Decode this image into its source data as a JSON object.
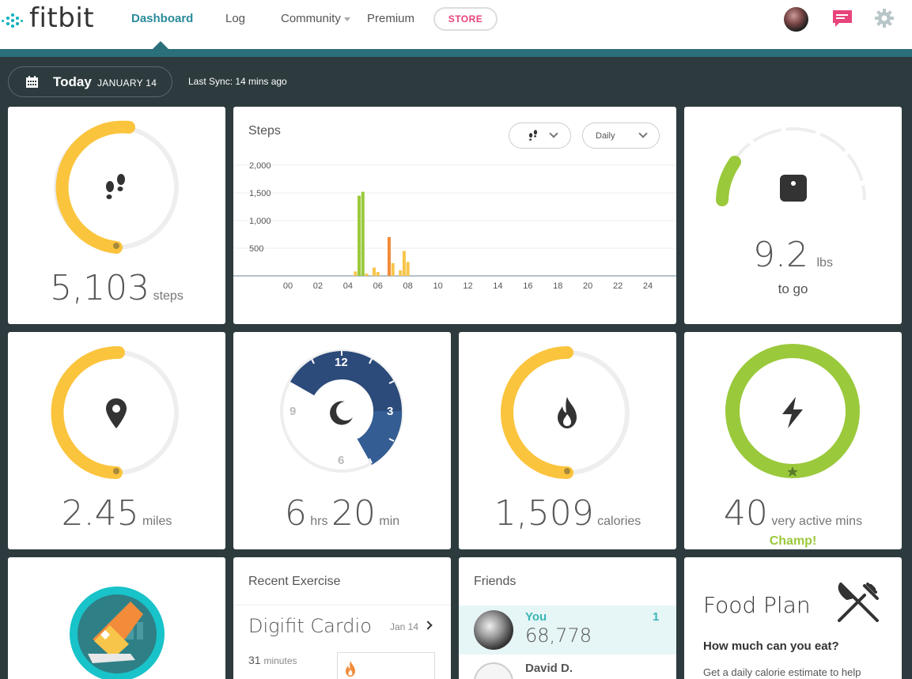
{
  "nav": {
    "logo_text": "fitbit",
    "items": [
      {
        "label": "Dashboard",
        "active": true
      },
      {
        "label": "Log",
        "active": false
      },
      {
        "label": "Community",
        "active": false
      },
      {
        "label": "Premium",
        "active": false
      }
    ],
    "store_label": "STORE",
    "icons": [
      "avatar",
      "message-icon",
      "gear-icon"
    ]
  },
  "datebar": {
    "today_label": "Today",
    "date_label": "JANUARY 14",
    "last_sync": "Last Sync: 14 mins ago"
  },
  "steps_tile": {
    "value": "5,103",
    "unit": "steps",
    "progress": 0.51,
    "icon": "footsteps-icon"
  },
  "steps_chart_card": {
    "title": "Steps",
    "type_dropdown_icon": "footsteps-icon",
    "period_dropdown": "Daily",
    "chart_data": {
      "type": "bar",
      "x_tick_labels": [
        "00",
        "02",
        "04",
        "06",
        "08",
        "10",
        "12",
        "14",
        "16",
        "18",
        "20",
        "22",
        "24"
      ],
      "y_tick_labels": [
        "2,000",
        "1,500",
        "1,000",
        "500"
      ],
      "ylim": [
        0,
        2000
      ],
      "xlim": [
        0,
        24
      ],
      "bars": [
        {
          "hour": 4.75,
          "value": 1450,
          "color": "#9ac93b"
        },
        {
          "hour": 5.0,
          "value": 1520,
          "color": "#9ac93b"
        },
        {
          "hour": 4.5,
          "value": 80,
          "color": "#f7c54a"
        },
        {
          "hour": 5.25,
          "value": 40,
          "color": "#f7c54a"
        },
        {
          "hour": 5.75,
          "value": 150,
          "color": "#f7c54a"
        },
        {
          "hour": 6.0,
          "value": 70,
          "color": "#f7c54a"
        },
        {
          "hour": 6.75,
          "value": 700,
          "color": "#f28b3a"
        },
        {
          "hour": 7.0,
          "value": 230,
          "color": "#f7c54a"
        },
        {
          "hour": 7.5,
          "value": 100,
          "color": "#f7c54a"
        },
        {
          "hour": 7.75,
          "value": 450,
          "color": "#f7c54a"
        },
        {
          "hour": 8.0,
          "value": 250,
          "color": "#f7c54a"
        }
      ]
    }
  },
  "weight_tile": {
    "value": "9.2",
    "unit": "lbs",
    "sublabel": "to go",
    "icon": "scale-icon"
  },
  "miles_tile": {
    "value": "2.45",
    "unit": "miles",
    "progress": 0.49,
    "icon": "location-pin-icon"
  },
  "sleep_tile": {
    "hours": "6",
    "hours_unit": "hrs",
    "minutes": "20",
    "minutes_unit": "min",
    "clock_labels": {
      "top": "12",
      "right": "3",
      "bottom": "6",
      "left": "9"
    },
    "icon": "moon-icon"
  },
  "calories_tile": {
    "value": "1,509",
    "unit": "calories",
    "progress": 0.5,
    "icon": "flame-icon"
  },
  "active_tile": {
    "value": "40",
    "unit": "very active mins",
    "badge": "Champ!",
    "progress": 1.0,
    "icon": "lightning-icon"
  },
  "badge_tile": {
    "icon": "shoe-badge-icon"
  },
  "exercise_card": {
    "title": "Recent Exercise",
    "activity": "Digifit Cardio",
    "date": "Jan 14",
    "duration_value": "31",
    "duration_unit": "minutes"
  },
  "friends_card": {
    "title": "Friends",
    "rows": [
      {
        "name": "You",
        "steps": "68,778",
        "rank": "1"
      },
      {
        "name": "David D.",
        "steps": "",
        "rank": ""
      }
    ]
  },
  "food_card": {
    "title": "Food Plan",
    "question": "How much can you eat?",
    "description": "Get a daily calorie estimate to help"
  },
  "colors": {
    "brand_teal": "#00b0b9",
    "nav_active": "#2a8a9a",
    "store_pink": "#e8437a",
    "yellow": "#fbc43d",
    "green": "#9ac93b",
    "sleep_blue": "#2c4a7a",
    "background": "#2d3b3e"
  }
}
